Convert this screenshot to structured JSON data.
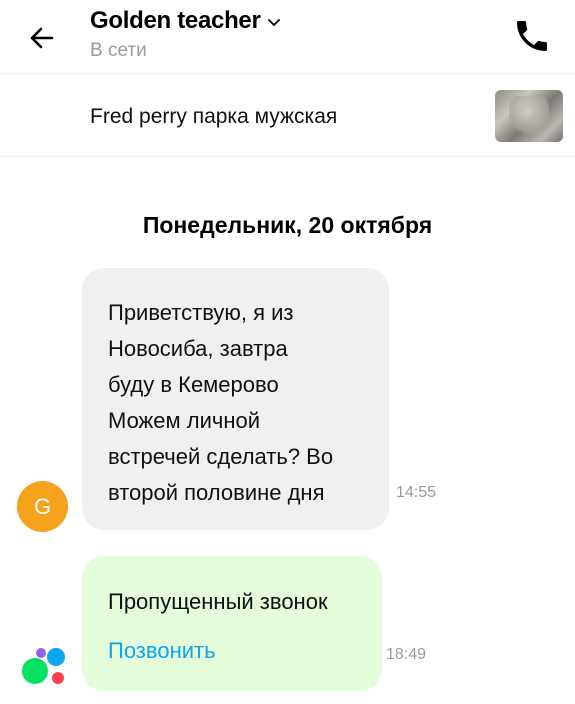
{
  "header": {
    "title": "Golden teacher",
    "status": "В сети",
    "icons": {
      "back": "arrow-left-icon",
      "dropdown": "chevron-down-icon",
      "call": "phone-icon"
    }
  },
  "item": {
    "title": "Fred perry парка мужская",
    "thumbnail": "item-photo"
  },
  "chat": {
    "date_separator": "Понедельник, 20 октября",
    "messages": [
      {
        "avatar_letter": "G",
        "avatar_color": "#f5a31c",
        "lines": [
          "Приветствую, я из",
          "Новосиба, завтра",
          "буду в Кемерово",
          "Можем личной",
          "встречей сделать? Во",
          "второй половине дня"
        ],
        "time": "14:55"
      },
      {
        "type": "missed-call",
        "text": "Пропущенный звонок",
        "action": "Позвонить",
        "action_color": "#0aa6f0",
        "time": "18:49"
      }
    ]
  },
  "colors": {
    "incoming_bubble": "#f0f0f0",
    "system_bubble": "#e4fcd9",
    "muted_text": "#9a9a9a"
  }
}
